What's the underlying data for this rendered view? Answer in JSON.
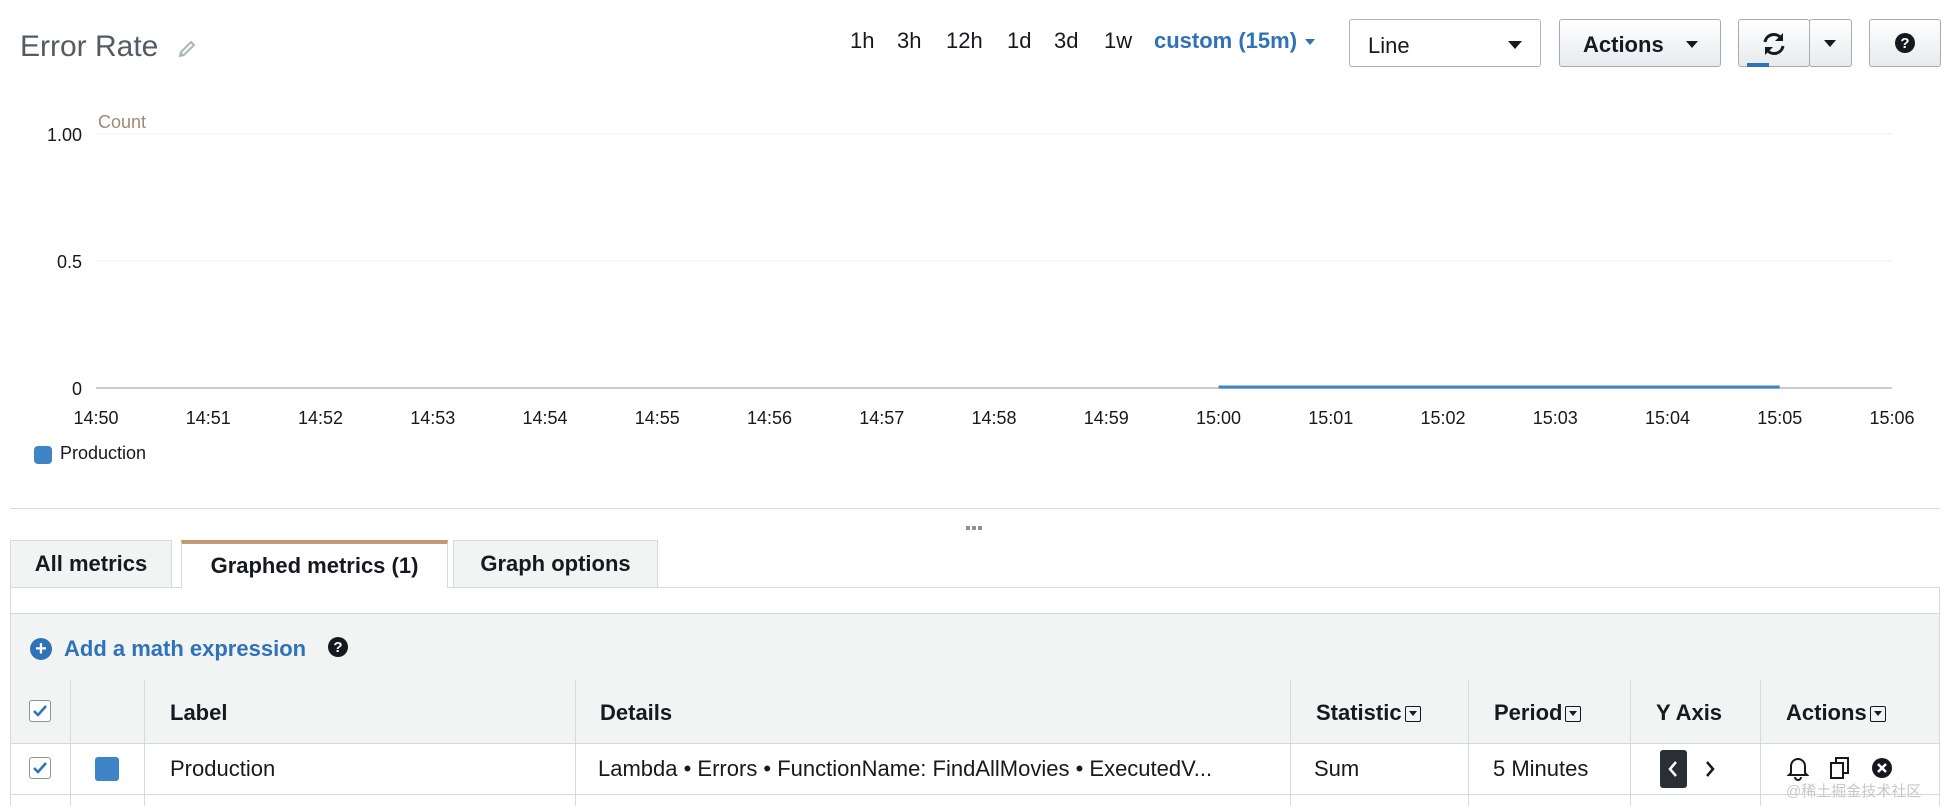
{
  "header": {
    "title": "Error Rate",
    "time_ranges": [
      "1h",
      "3h",
      "12h",
      "1d",
      "3d",
      "1w"
    ],
    "custom_range": "custom (15m)",
    "chart_type": "Line",
    "actions_label": "Actions"
  },
  "chart_data": {
    "type": "line",
    "ylabel": "Count",
    "yticks": [
      "1.00",
      "0.5",
      "0"
    ],
    "ylim": [
      0,
      1
    ],
    "x_ticks": [
      "14:50",
      "14:51",
      "14:52",
      "14:53",
      "14:54",
      "14:55",
      "14:56",
      "14:57",
      "14:58",
      "14:59",
      "15:00",
      "15:01",
      "15:02",
      "15:03",
      "15:04",
      "15:05",
      "15:06"
    ],
    "series": [
      {
        "name": "Production",
        "color": "#3d85c6",
        "x": [
          "15:00",
          "15:05"
        ],
        "y": [
          0,
          0
        ]
      }
    ],
    "grid": true,
    "legend_position": "bottom-left"
  },
  "tabs": {
    "all_metrics": "All metrics",
    "graphed_metrics": "Graphed metrics (1)",
    "graph_options": "Graph options"
  },
  "math": {
    "add_label": "Add a math expression"
  },
  "table": {
    "columns": {
      "label": "Label",
      "details": "Details",
      "statistic": "Statistic",
      "period": "Period",
      "y_axis": "Y Axis",
      "actions": "Actions"
    },
    "rows": [
      {
        "checked": true,
        "color": "#3d85c6",
        "label": "Production",
        "details": "Lambda • Errors • FunctionName: FindAllMovies • ExecutedV...",
        "statistic": "Sum",
        "period": "5 Minutes"
      }
    ]
  },
  "watermark": "@稀土掘金技术社区"
}
